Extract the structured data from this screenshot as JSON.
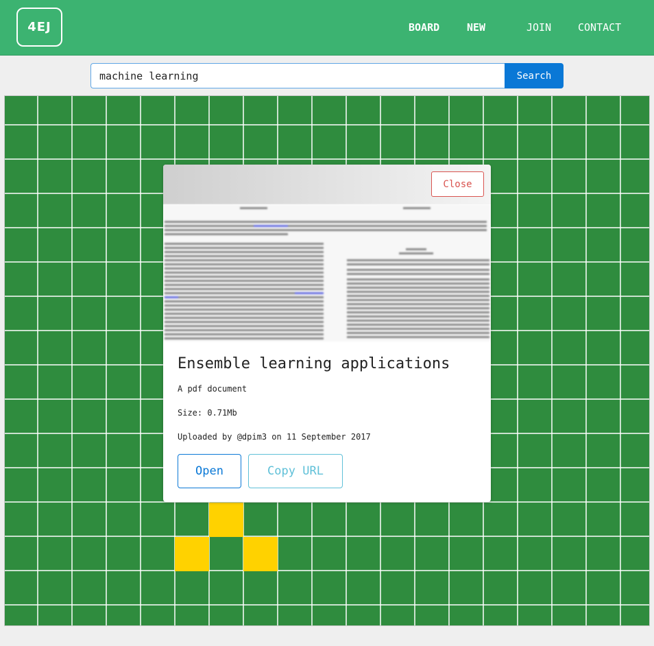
{
  "header": {
    "logo": "4EJ",
    "nav": [
      "BOARD",
      "NEW",
      "JOIN",
      "CONTACT"
    ]
  },
  "search": {
    "value": "machine learning",
    "button": "Search"
  },
  "board": {
    "cell_color": "#2f8c3e",
    "highlight_color": "#ffd200"
  },
  "modal": {
    "close": "Close",
    "title": "Ensemble learning applications",
    "type": "A pdf document",
    "size": "Size: 0.71Mb",
    "uploaded": "Uploaded by @dpim3 on 11 September 2017",
    "open": "Open",
    "copy_url": "Copy URL"
  },
  "colors": {
    "header": "#3cb371",
    "primary": "#0a78d6",
    "danger": "#d9534f",
    "info": "#5fc0d8"
  }
}
